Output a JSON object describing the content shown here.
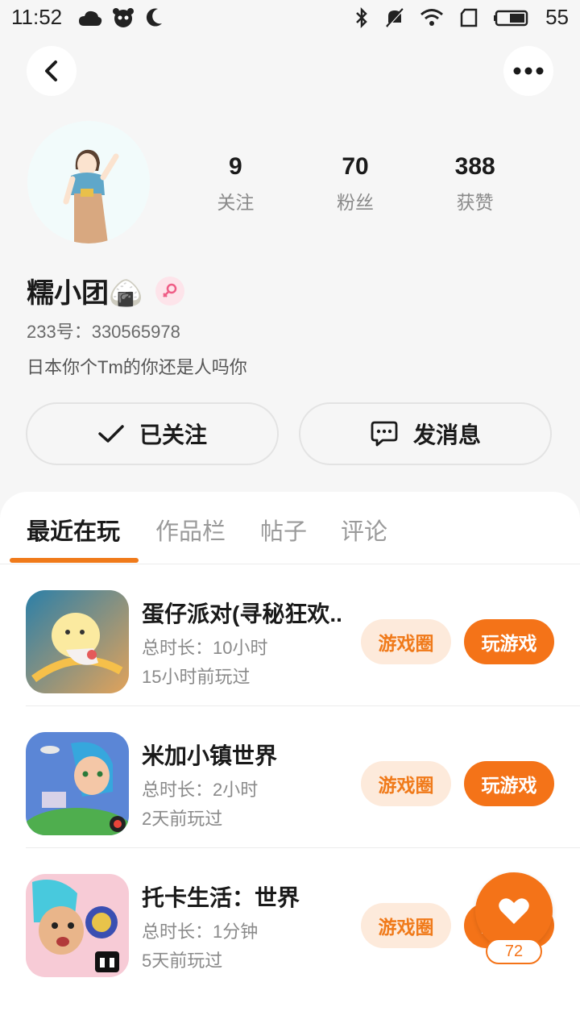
{
  "status_bar": {
    "time": "11:52",
    "battery_level": "55",
    "icons": [
      "cloud-icon",
      "panda-icon",
      "moon-icon",
      "bluetooth-icon",
      "mute-icon",
      "wifi-icon",
      "sim-icon",
      "battery-icon"
    ]
  },
  "profile": {
    "stats": [
      {
        "value": "9",
        "label": "关注"
      },
      {
        "value": "70",
        "label": "粉丝"
      },
      {
        "value": "388",
        "label": "获赞"
      }
    ],
    "nickname": "糯小团🍙",
    "uid": "233号：330565978",
    "bio": "日本你个Tm的你还是人吗你",
    "followed_label": "已关注",
    "message_label": "发消息"
  },
  "tabs": [
    {
      "label": "最近在玩",
      "active": true
    },
    {
      "label": "作品栏",
      "active": false
    },
    {
      "label": "帖子",
      "active": false
    },
    {
      "label": "评论",
      "active": false
    }
  ],
  "games": [
    {
      "title": "蛋仔派对(寻秘狂欢..",
      "duration": "总时长：10小时",
      "last_played": "15小时前玩过",
      "circle_label": "游戏圈",
      "play_label": "玩游戏"
    },
    {
      "title": "米加小镇世界",
      "duration": "总时长：2小时",
      "last_played": "2天前玩过",
      "circle_label": "游戏圈",
      "play_label": "玩游戏"
    },
    {
      "title": "托卡生活：世界",
      "duration": "总时长：1分钟",
      "last_played": "5天前玩过",
      "circle_label": "游戏圈",
      "play_label": "玩游戏"
    }
  ],
  "floating_like": {
    "count": "72"
  },
  "colors": {
    "accent": "#f47318",
    "accent_light": "#fdeadb",
    "background": "#f6f6f6"
  }
}
